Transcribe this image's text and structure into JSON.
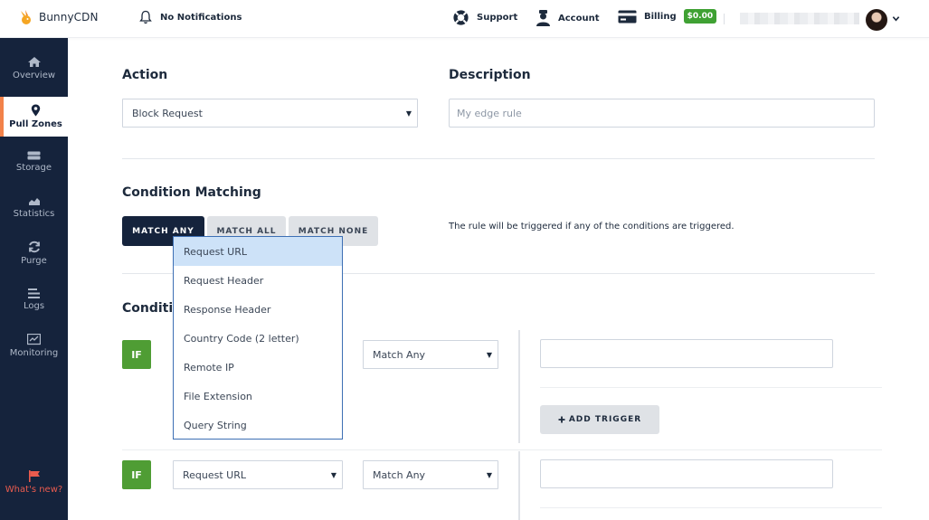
{
  "topbar": {
    "brand": "BunnyCDN",
    "notifications": "No Notifications",
    "support": "Support",
    "account": "Account",
    "billing": "Billing",
    "balance": "$0.00"
  },
  "sidebar": {
    "items": [
      {
        "label": "Overview",
        "icon": "home-icon"
      },
      {
        "label": "Pull Zones",
        "icon": "map-pin-icon"
      },
      {
        "label": "Storage",
        "icon": "storage-icon"
      },
      {
        "label": "Statistics",
        "icon": "chart-icon"
      },
      {
        "label": "Purge",
        "icon": "refresh-icon"
      },
      {
        "label": "Logs",
        "icon": "logs-icon"
      },
      {
        "label": "Monitoring",
        "icon": "monitor-icon"
      }
    ],
    "whats_new": "What's new?"
  },
  "form": {
    "action_title": "Action",
    "action_value": "Block Request",
    "description_title": "Description",
    "description_placeholder": "My edge rule",
    "condition_matching_title": "Condition Matching",
    "tabs": [
      "MATCH ANY",
      "MATCH ALL",
      "MATCH NONE"
    ],
    "hint": "The rule will be triggered if any of the conditions are triggered.",
    "conditions_title": "Conditio"
  },
  "conditions": [
    {
      "if": "IF",
      "match": "Match Any",
      "add_trigger": "ADD TRIGGER"
    },
    {
      "if": "IF",
      "type": "Request URL",
      "match": "Match Any"
    }
  ],
  "dropdown": {
    "options": [
      "Request URL",
      "Request Header",
      "Response Header",
      "Country Code (2 letter)",
      "Remote IP",
      "File Extension",
      "Query String"
    ],
    "highlighted": "Request URL"
  },
  "colors": {
    "sidebar": "#15233c",
    "accent": "#f2824a",
    "if_green": "#4f9d34",
    "highlight": "#cde2f8"
  }
}
